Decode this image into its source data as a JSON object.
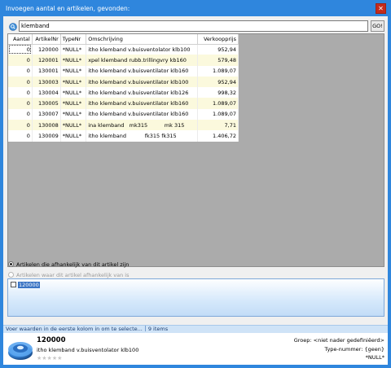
{
  "window": {
    "title": "Invoegen aantal en artikelen, gevonden:",
    "close_icon": "close-icon"
  },
  "search": {
    "value": "klemband",
    "go_label": "GO!"
  },
  "table": {
    "headers": {
      "aantal": "Aantal",
      "artikelnr": "ArtikelNr",
      "typenr": "TypeNr",
      "omschrijving": "Omschrijving",
      "verkoopprijs": "Verkoopprijs"
    },
    "rows": [
      {
        "aantal": "0",
        "artikelnr": "120000",
        "typenr": "*NULL*",
        "omschrijving": "itho klemband v.buisventolator klb100",
        "verkoopprijs": "952,94"
      },
      {
        "aantal": "0",
        "artikelnr": "120001",
        "typenr": "*NULL*",
        "omschrijving": "xpel klemband rubb.trillingvry kb160",
        "verkoopprijs": "579,48"
      },
      {
        "aantal": "0",
        "artikelnr": "130001",
        "typenr": "*NULL*",
        "omschrijving": "itho klemband v.buisventilator klb160",
        "verkoopprijs": "1.089,07"
      },
      {
        "aantal": "0",
        "artikelnr": "130003",
        "typenr": "*NULL*",
        "omschrijving": "itho klemband v.buisventilator klb100",
        "verkoopprijs": "952,94"
      },
      {
        "aantal": "0",
        "artikelnr": "130004",
        "typenr": "*NULL*",
        "omschrijving": "itho klemband v.buisventilator klb126",
        "verkoopprijs": "998,32"
      },
      {
        "aantal": "0",
        "artikelnr": "130005",
        "typenr": "*NULL*",
        "omschrijving": "itho klemband v.buisventilator klb160",
        "verkoopprijs": "1.089,07"
      },
      {
        "aantal": "0",
        "artikelnr": "130007",
        "typenr": "*NULL*",
        "omschrijving": "itho klemband v.buisventilator klb160",
        "verkoopprijs": "1.089,07"
      },
      {
        "aantal": "0",
        "artikelnr": "130008",
        "typenr": "*NULL*",
        "omschrijving": "ina klemband   mk315          mk 315",
        "verkoopprijs": "7,71"
      },
      {
        "aantal": "0",
        "artikelnr": "130009",
        "typenr": "*NULL*",
        "omschrijving": "itho klemband           fk315 fk315",
        "verkoopprijs": "1.406,72"
      }
    ]
  },
  "options": {
    "radio1_label": "Artikelen die afhankelijk van dit artikel zijn",
    "radio2_label": "Artikelen waar dit artikel afhankelijk van is"
  },
  "lower_list": {
    "items": [
      "120000"
    ]
  },
  "status": {
    "hint": "Voer waarden in de eerste kolom in om te selecte...",
    "count": "9 items"
  },
  "product": {
    "code": "120000",
    "description": "itho klemband v.buisventolator klb100",
    "stars": "★★★★★",
    "groep": "Groep: <niet nader gedefiniëerd>",
    "type_nummer": "Type-nummer: {geen}",
    "null_value": "*NULL*"
  },
  "colors": {
    "title_bar": "#2f86dd",
    "row_alt": "#fbf9dd",
    "grid_bg": "#ababab"
  }
}
